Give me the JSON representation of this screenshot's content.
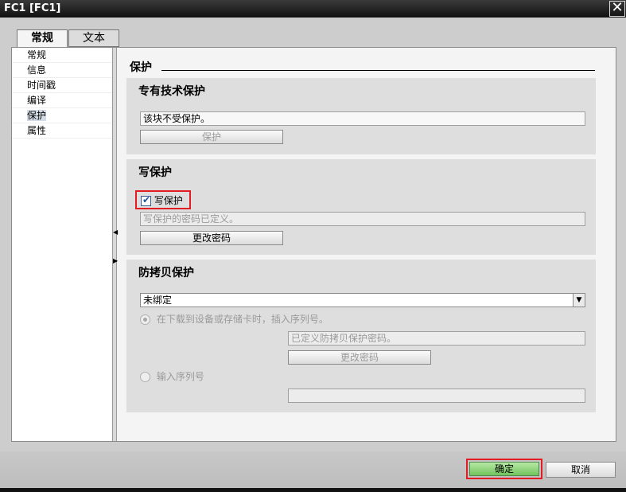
{
  "window": {
    "title": "FC1 [FC1]",
    "close_symbol": "✕"
  },
  "tabs": [
    {
      "label": "常规"
    },
    {
      "label": "文本"
    }
  ],
  "nav": {
    "items": [
      {
        "label": "常规"
      },
      {
        "label": "信息"
      },
      {
        "label": "时间戳"
      },
      {
        "label": "编译"
      },
      {
        "label": "保护"
      },
      {
        "label": "属性"
      }
    ],
    "selected_index": 4
  },
  "page": {
    "title": "保护"
  },
  "know_how": {
    "title": "专有技术保护",
    "status": "该块不受保护。",
    "button": "保护"
  },
  "write_protection": {
    "title": "写保护",
    "checkbox_label": "写保护",
    "checked": true,
    "status": "写保护的密码已定义。",
    "button": "更改密码"
  },
  "copy_protection": {
    "title": "防拷贝保护",
    "select_value": "未绑定",
    "radio1_label": "在下载到设备或存储卡时，插入序列号。",
    "password_status": "已定义防拷贝保护密码。",
    "change_button": "更改密码",
    "radio2_label": "输入序列号",
    "serial_value": ""
  },
  "footer": {
    "ok_label": "确定",
    "cancel_label": "取消"
  },
  "colors": {
    "highlight_border": "#e31b23",
    "ok_button": "#72c35d"
  }
}
